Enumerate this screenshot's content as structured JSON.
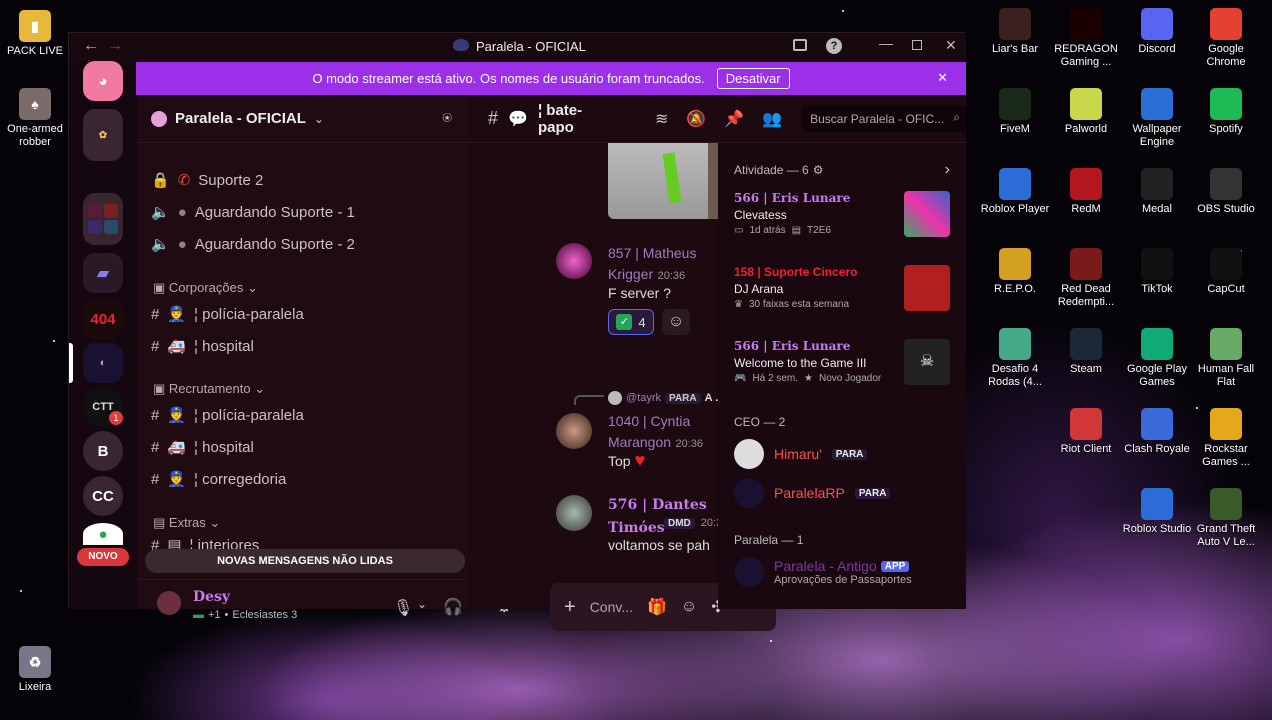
{
  "desktop": {
    "left_icons": [
      {
        "label": "PACK LIVE",
        "icon": "folder-icon",
        "color": "#e8b83a"
      },
      {
        "label": "One-armed robber",
        "icon": "game-icon",
        "color": "#7a6a6a"
      },
      {
        "label": "Lixeira",
        "icon": "recycle-bin-icon",
        "color": "#9aa"
      }
    ],
    "right_icons": [
      {
        "label": "Liar's Bar",
        "icon": "game-icon",
        "color": "#3a2020"
      },
      {
        "label": "REDRAGON Gaming ...",
        "icon": "redragon-icon",
        "color": "#1a0000"
      },
      {
        "label": "Discord",
        "icon": "discord-icon",
        "color": "#5865f2"
      },
      {
        "label": "Google Chrome",
        "icon": "chrome-icon",
        "color": "#e34133"
      },
      {
        "label": "FiveM",
        "icon": "fivem-icon",
        "color": "#1a2a1a"
      },
      {
        "label": "Palworld",
        "icon": "palworld-icon",
        "color": "#c8d84a"
      },
      {
        "label": "Wallpaper Engine",
        "icon": "wallpaper-engine-icon",
        "color": "#2a6fd6"
      },
      {
        "label": "Spotify",
        "icon": "spotify-icon",
        "color": "#1db954"
      },
      {
        "label": "Roblox Player",
        "icon": "roblox-icon",
        "color": "#2b6cd6"
      },
      {
        "label": "RedM",
        "icon": "redm-icon",
        "color": "#b3161d"
      },
      {
        "label": "Medal",
        "icon": "medal-icon",
        "color": "#222"
      },
      {
        "label": "OBS Studio",
        "icon": "obs-icon",
        "color": "#333"
      },
      {
        "label": "R.E.P.O.",
        "icon": "repo-icon",
        "color": "#d4a022"
      },
      {
        "label": "Red Dead Redempti...",
        "icon": "rdr-icon",
        "color": "#7a1a1a"
      },
      {
        "label": "TikTok",
        "icon": "tiktok-icon",
        "color": "#111"
      },
      {
        "label": "CapCut",
        "icon": "capcut-icon",
        "color": "#111"
      },
      {
        "label": "Desafio 4 Rodas (4...",
        "icon": "game-icon",
        "color": "#4a8"
      },
      {
        "label": "Steam",
        "icon": "steam-icon",
        "color": "#1b2838"
      },
      {
        "label": "Google Play Games",
        "icon": "play-games-icon",
        "color": "#1a7"
      },
      {
        "label": "Human Fall Flat",
        "icon": "game-icon",
        "color": "#6a6"
      },
      {
        "label": "Riot Client",
        "icon": "riot-icon",
        "color": "#d13639"
      },
      {
        "label": "Clash Royale",
        "icon": "game-icon",
        "color": "#3a6ad8"
      },
      {
        "label": "Rockstar Games ...",
        "icon": "rockstar-icon",
        "color": "#e6a81a"
      },
      {
        "label": "Roblox Studio",
        "icon": "roblox-studio-icon",
        "color": "#2b6cd6"
      },
      {
        "label": "Grand Theft Auto V Le...",
        "icon": "gta-icon",
        "color": "#3a5a2a"
      }
    ]
  },
  "window": {
    "title": "Paralela - OFICIAL",
    "back": "←",
    "forward": "→",
    "banner_text": "O modo streamer está ativo. Os nomes de usuário foram truncados.",
    "banner_button": "Desativar",
    "banner_close": "✕"
  },
  "guilds": {
    "items": [
      {
        "label": "",
        "icon": "discord-home-icon",
        "color": "#f07aa0"
      },
      {
        "label": "",
        "icon": "server-folder-icon",
        "color": "#3a2630"
      },
      {
        "label": "",
        "icon": "server-folder-icon",
        "color": "#3a2630"
      },
      {
        "label": "",
        "icon": "folder-icon",
        "color": "#2a1a25"
      },
      {
        "label": "404",
        "icon": "server-404-icon",
        "color": "#1a0a0a"
      },
      {
        "label": "",
        "icon": "paralela-icon",
        "color": "#1a1030"
      },
      {
        "label": "CTT",
        "icon": "ctt-icon",
        "color": "#111"
      },
      {
        "label": "B",
        "icon": "",
        "color": "#3a2630"
      },
      {
        "label": "CC",
        "icon": "",
        "color": "#3a2630"
      },
      {
        "label": "",
        "icon": "add-server-icon",
        "color": "#23a55a"
      }
    ],
    "badge": "1",
    "new_badge": "NOVO"
  },
  "server": {
    "name": "Paralela - OFICIAL",
    "channels": [
      {
        "label": "Suporte 2",
        "icon": "lock-icon",
        "type": "text"
      },
      {
        "label": "Aguardando Suporte - 1",
        "icon": "voice-icon",
        "type": "voice"
      },
      {
        "label": "Aguardando Suporte - 2",
        "icon": "voice-icon",
        "type": "voice"
      }
    ],
    "categories": [
      {
        "label": "Corporações",
        "channels": [
          "¦ polícia-paralela",
          "¦ hospital"
        ]
      },
      {
        "label": "Recrutamento",
        "channels": [
          "¦ polícia-paralela",
          "¦ hospital",
          "¦ corregedoria"
        ]
      },
      {
        "label": "Extras",
        "channels": [
          "¦ interiores"
        ]
      }
    ],
    "unread_bar": "NOVAS MENSAGENS NÃO LIDAS"
  },
  "user": {
    "name": "Desy",
    "status": "Eclesiastes 3",
    "status_prefix": "+1"
  },
  "chat": {
    "channel_name": "¦ bate-papo",
    "search_placeholder": "Buscar Paralela - OFIC...",
    "messages": [
      {
        "author": "857 | Matheus Krigger",
        "time": "20:36",
        "text": "F server ?",
        "reaction": "✅",
        "reaction_count": "4",
        "author_color": "#9b7fbf"
      },
      {
        "author": "1040 | Cyntia Marangon",
        "time": "20:36",
        "text": "Top",
        "reply_to": "@tayrk",
        "reply_tag": "PARA",
        "reply_text": "A ...",
        "author_color": "#9b7fbf"
      },
      {
        "author": "576 | Dantes Timóes",
        "time": "20:38",
        "text": "voltamos se pah",
        "tag": "DMD",
        "author_color": "#c97bf0"
      }
    ],
    "input_placeholder": "Conv..."
  },
  "members": {
    "activity_header": "Atividade — 6",
    "activities": [
      {
        "user": "566 | Eris Lunare",
        "title": "Clevatess",
        "meta1": "1d atrás",
        "meta2": "T2E6"
      },
      {
        "user": "158 | Suporte Cincero",
        "title": "DJ Arana",
        "meta1": "30 faixas esta semana",
        "meta2": ""
      },
      {
        "user": "566 | Eris Lunare",
        "title": "Welcome to the Game III",
        "meta1": "Há 2 sem.",
        "meta2": "Novo Jogador"
      }
    ],
    "ceo_header": "CEO — 2",
    "ceo": [
      {
        "name": "Himaru'",
        "tag": "PARA"
      },
      {
        "name": "ParalelaRP",
        "tag": "PARA"
      }
    ],
    "paralela_header": "Paralela — 1",
    "paralela": [
      {
        "name": "Paralela - Antigo",
        "tag": "APP",
        "sub": "Aprovações de Passaportes"
      }
    ]
  }
}
